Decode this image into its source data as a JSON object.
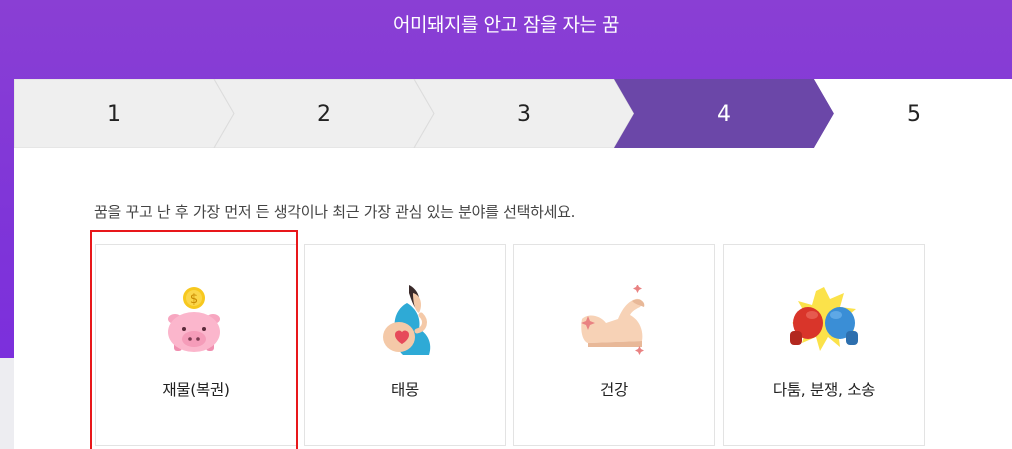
{
  "header": {
    "title": "어미돼지를 안고 잠을 자는 꿈"
  },
  "steps": [
    {
      "number": "1",
      "active": false
    },
    {
      "number": "2",
      "active": false
    },
    {
      "number": "3",
      "active": false
    },
    {
      "number": "4",
      "active": true
    },
    {
      "number": "5",
      "active": false
    }
  ],
  "colors": {
    "header": "#8a3fd4",
    "active_step": "#6b47a8",
    "inactive_step": "#efefef",
    "selected_border": "#e8171a"
  },
  "instruction": "꿈을 꾸고 난 후 가장 먼저 든 생각이나 최근 가장 관심 있는 분야를 선택하세요.",
  "options": [
    {
      "label": "재물(복권)",
      "icon": "piggy-bank-coin-icon",
      "selected": true
    },
    {
      "label": "태몽",
      "icon": "pregnant-woman-heart-icon",
      "selected": false
    },
    {
      "label": "건강",
      "icon": "flexed-arm-icon",
      "selected": false
    },
    {
      "label": "다툼, 분쟁, 소송",
      "icon": "boxing-gloves-clash-icon",
      "selected": false
    }
  ]
}
